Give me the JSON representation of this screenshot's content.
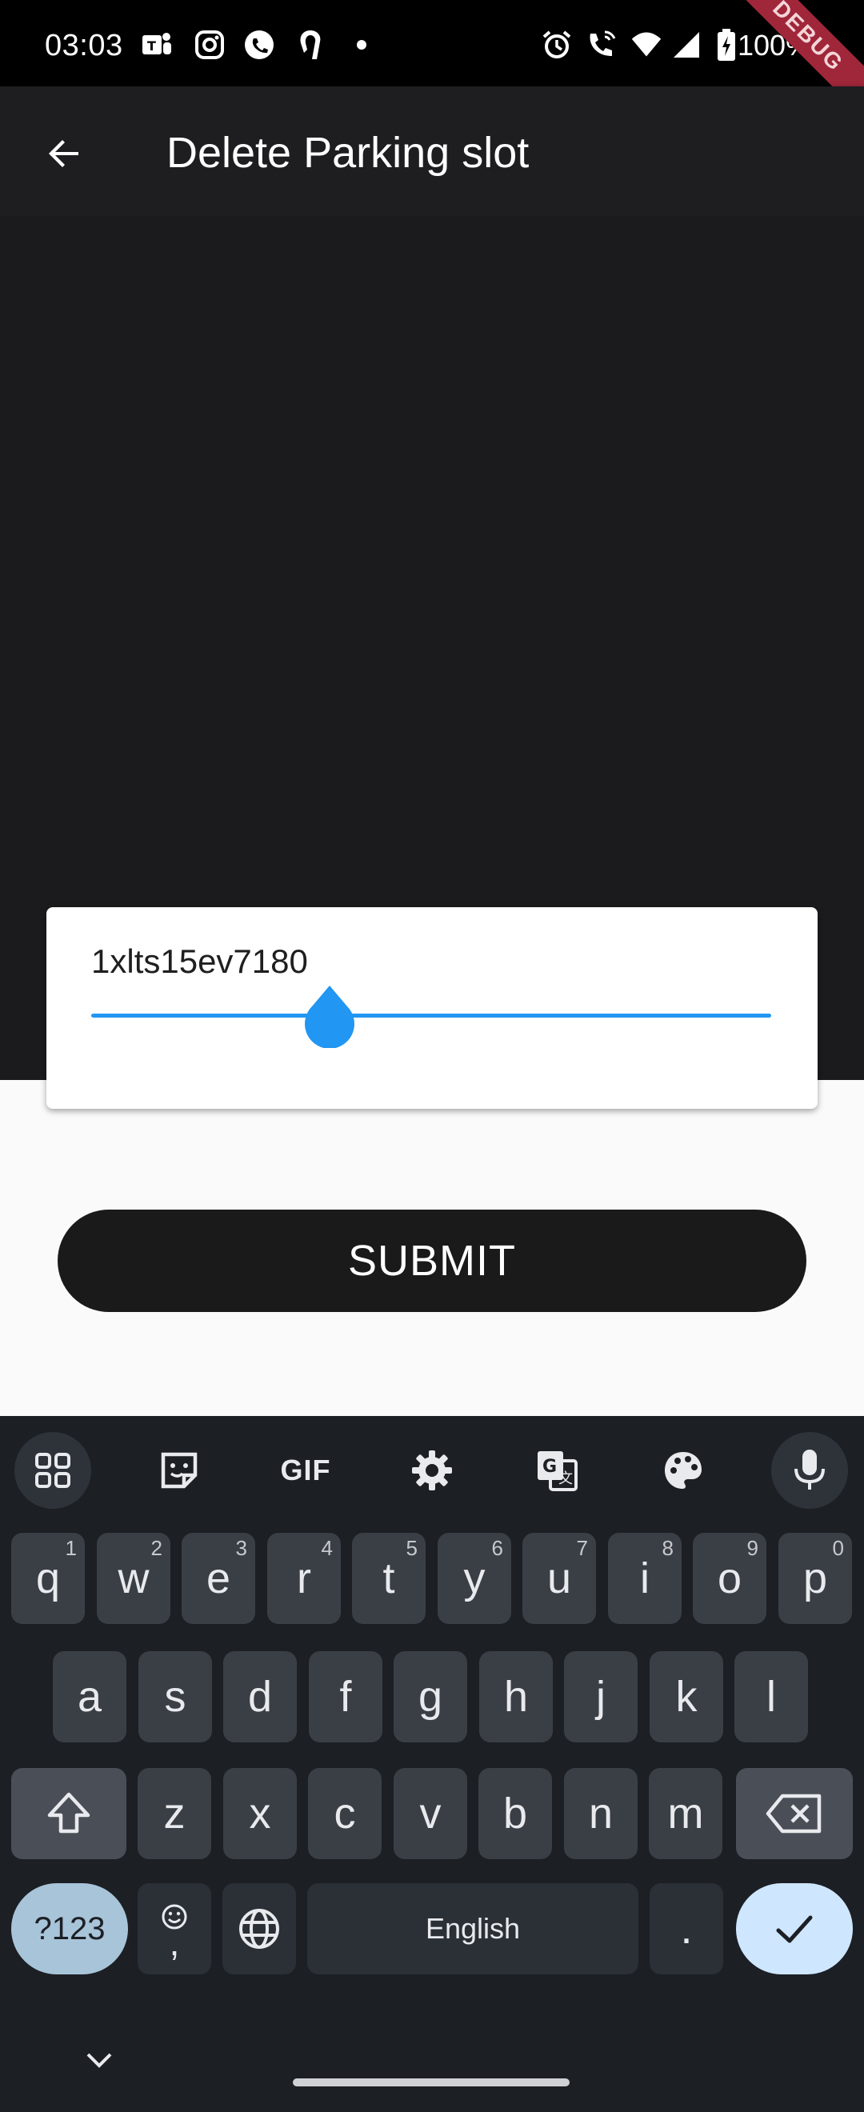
{
  "status_bar": {
    "time": "03:03",
    "battery": "100%",
    "debug_banner": "DEBUG"
  },
  "app_bar": {
    "title": "Delete Parking slot"
  },
  "card": {
    "value": "1xlts15ev7180",
    "slider_level": 0.35
  },
  "submit": {
    "label": "SUBMIT"
  },
  "keyboard": {
    "toolbar": [
      "apps-icon",
      "sticker-icon",
      "gif-icon",
      "settings-icon",
      "translate-icon",
      "palette-icon",
      "mic-icon"
    ],
    "gif_label": "GIF",
    "row1": [
      {
        "k": "q",
        "h": "1"
      },
      {
        "k": "w",
        "h": "2"
      },
      {
        "k": "e",
        "h": "3"
      },
      {
        "k": "r",
        "h": "4"
      },
      {
        "k": "t",
        "h": "5"
      },
      {
        "k": "y",
        "h": "6"
      },
      {
        "k": "u",
        "h": "7"
      },
      {
        "k": "i",
        "h": "8"
      },
      {
        "k": "o",
        "h": "9"
      },
      {
        "k": "p",
        "h": "0"
      }
    ],
    "row2": [
      "a",
      "s",
      "d",
      "f",
      "g",
      "h",
      "j",
      "k",
      "l"
    ],
    "row3": [
      "z",
      "x",
      "c",
      "v",
      "b",
      "n",
      "m"
    ],
    "sym_label": "?123",
    "emoji_comma": ",",
    "space_label": "English",
    "period_label": ".",
    "accent_color": "#2196f3"
  }
}
